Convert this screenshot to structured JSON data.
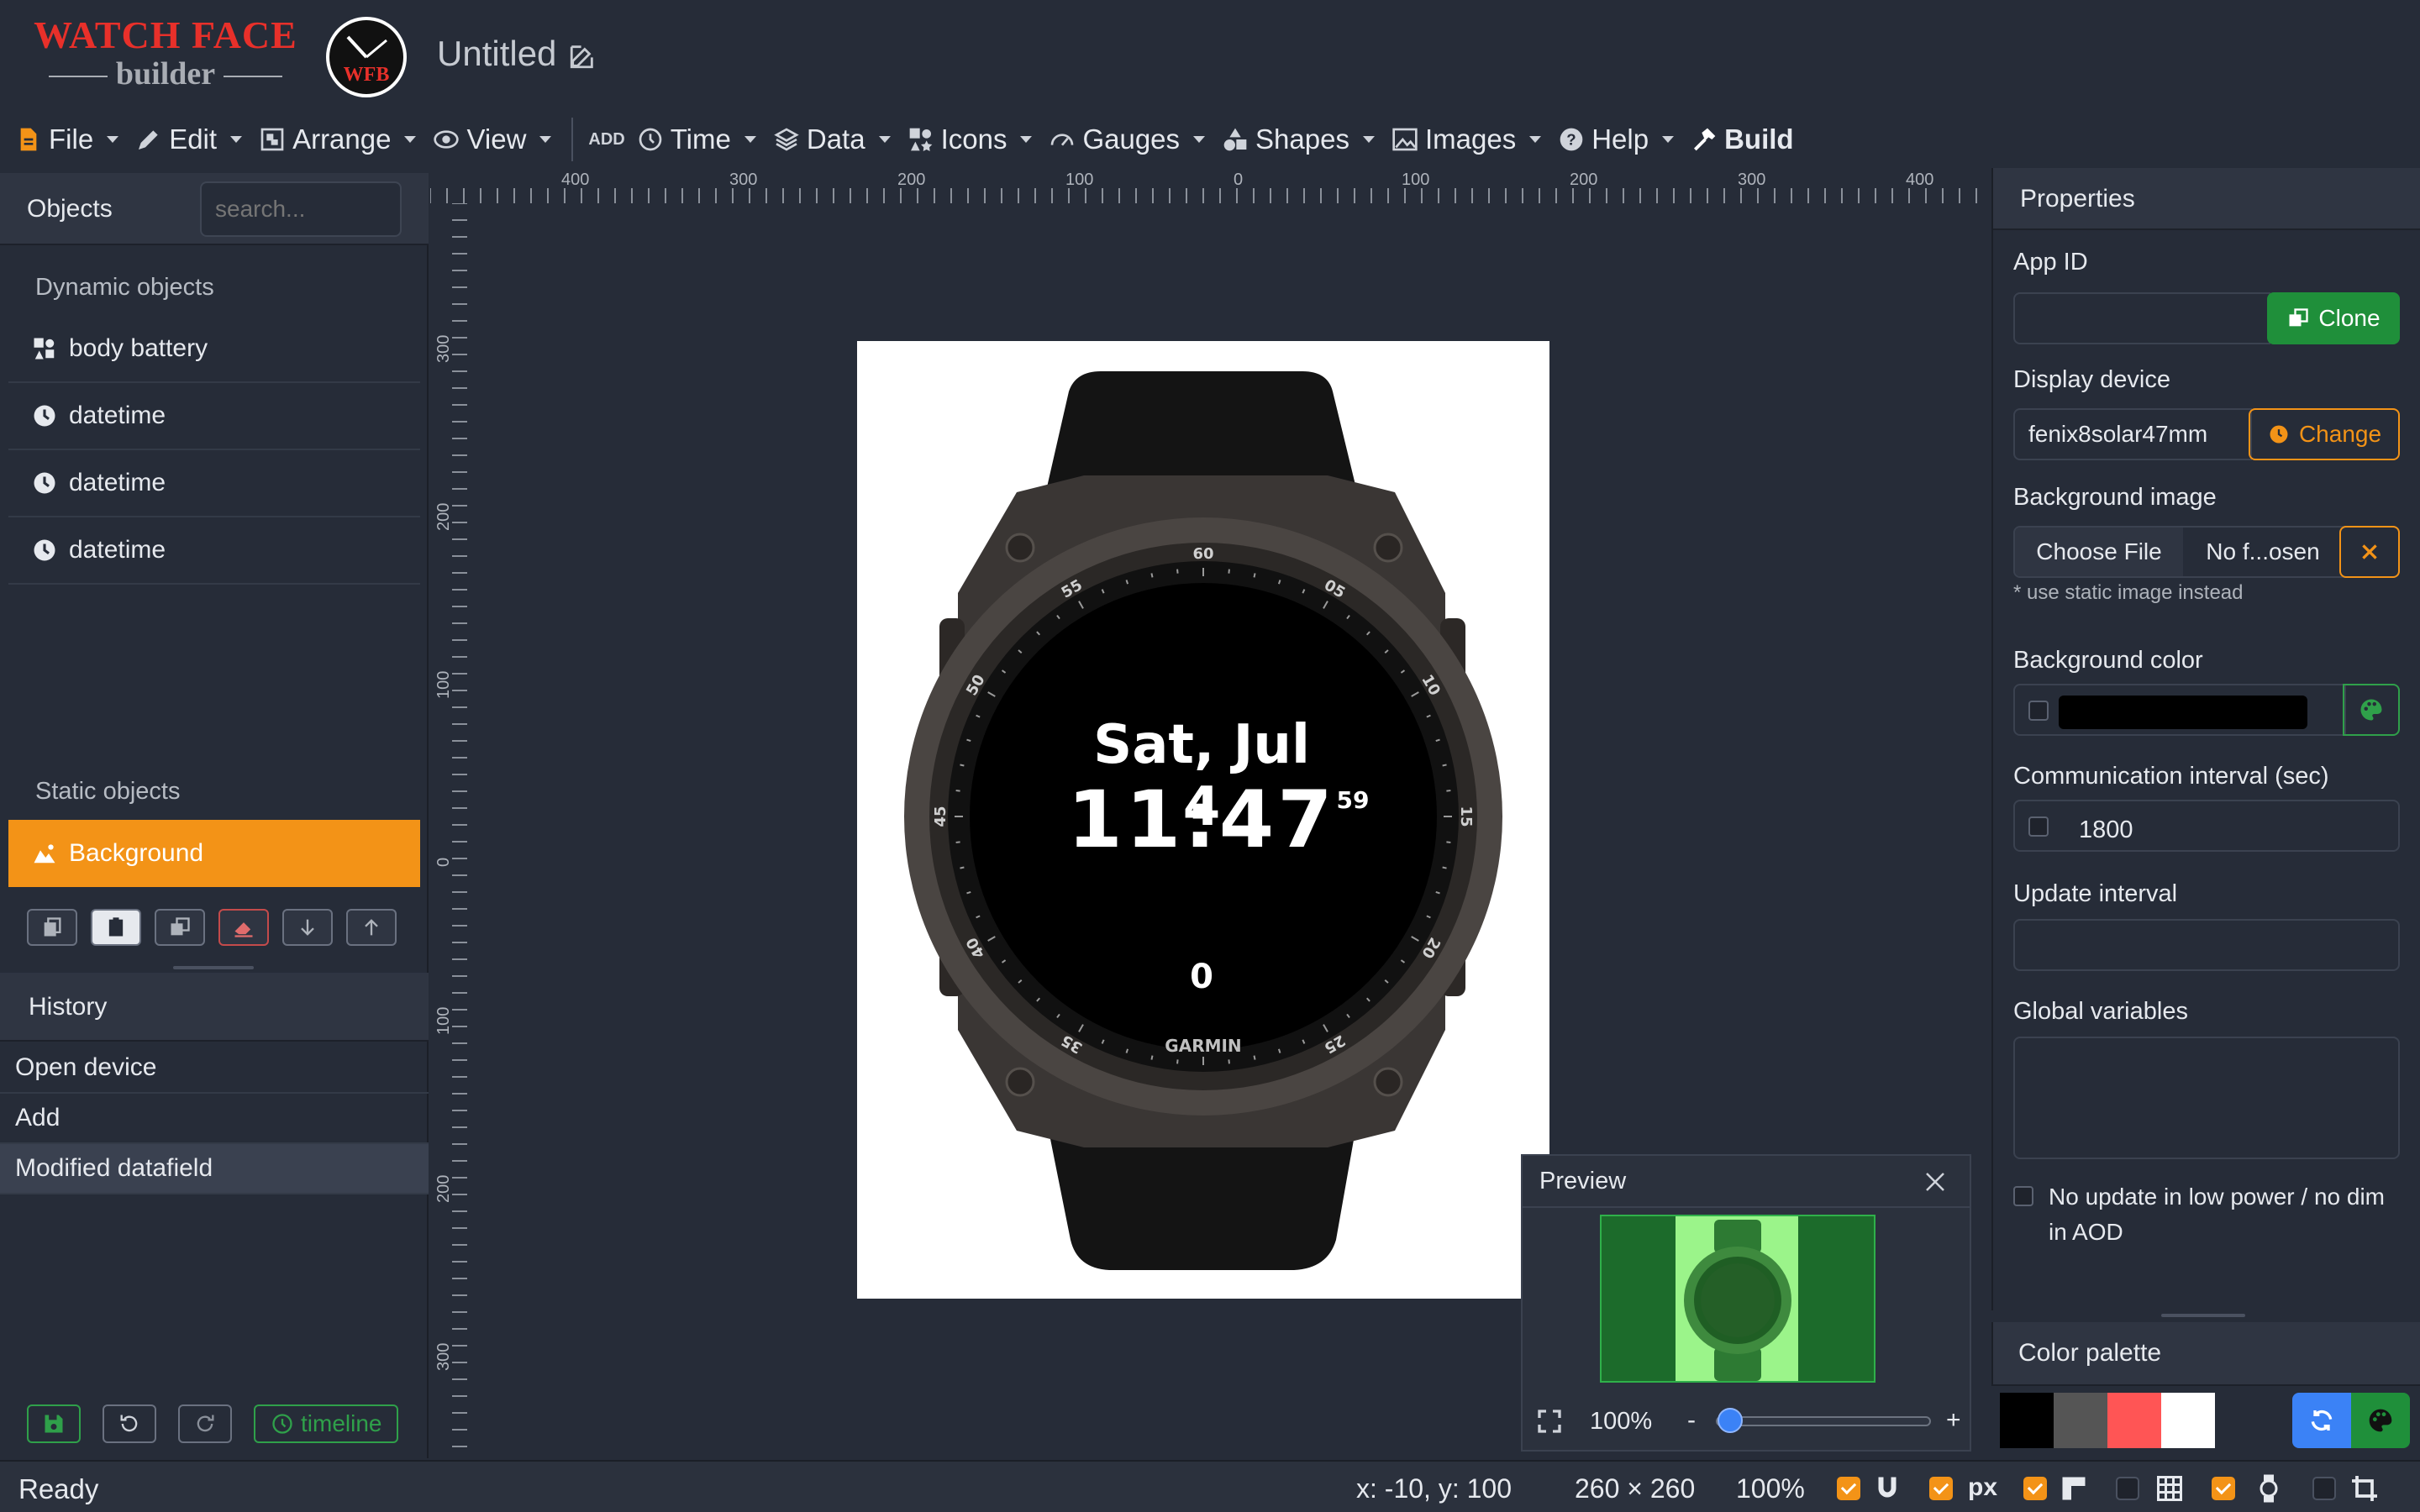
{
  "header": {
    "logo_line1": "WATCH FACE",
    "logo_line2": "builder",
    "badge_text": "WFB",
    "doc_title": "Untitled"
  },
  "menu": {
    "file": "File",
    "edit": "Edit",
    "arrange": "Arrange",
    "view": "View",
    "add": "ADD",
    "time": "Time",
    "data": "Data",
    "icons": "Icons",
    "gauges": "Gauges",
    "shapes": "Shapes",
    "images": "Images",
    "help": "Help",
    "build": "Build"
  },
  "objects": {
    "title": "Objects",
    "search_placeholder": "search...",
    "dynamic_title": "Dynamic objects",
    "dynamic_items": [
      {
        "label": "body battery",
        "icon": "data-icon"
      },
      {
        "label": "datetime",
        "icon": "clock-icon"
      },
      {
        "label": "datetime",
        "icon": "clock-icon"
      },
      {
        "label": "datetime",
        "icon": "clock-icon"
      }
    ],
    "static_title": "Static objects",
    "static_items": [
      {
        "label": "Background",
        "icon": "image-icon",
        "selected": true
      }
    ]
  },
  "history": {
    "title": "History",
    "items": [
      "Open device",
      "Add",
      "Modified datafield"
    ],
    "timeline_label": "timeline"
  },
  "rulers": {
    "top_labels": [
      "400",
      "300",
      "200",
      "100",
      "0",
      "100",
      "200",
      "300",
      "400"
    ],
    "left_labels": [
      "300",
      "200",
      "100",
      "0",
      "100",
      "200",
      "300"
    ]
  },
  "watch": {
    "date": "Sat, Jul 4",
    "time": "11:47",
    "seconds": "59",
    "battery": "0",
    "brand": "GARMIN",
    "bezel_numbers": [
      "60",
      "05",
      "10",
      "15",
      "20",
      "25",
      "35",
      "40",
      "45",
      "50",
      "55"
    ]
  },
  "preview": {
    "title": "Preview",
    "zoom": "100%",
    "zoom_fraction": 0.05,
    "minus": "-",
    "plus": "+"
  },
  "properties": {
    "title": "Properties",
    "app_id_label": "App ID",
    "app_id_value": "",
    "clone_label": "Clone",
    "display_device_label": "Display device",
    "display_device_value": "fenix8solar47mm",
    "change_label": "Change",
    "bg_image_label": "Background image",
    "choose_file_label": "Choose File",
    "file_name": "No f...osen",
    "bg_note": "* use static image instead",
    "bg_color_label": "Background color",
    "bg_color_value": "#000000",
    "comm_interval_label": "Communication interval (sec)",
    "comm_interval_value": "1800",
    "update_interval_label": "Update interval",
    "globals_label": "Global variables",
    "no_update_label": "No update in low power / no dim in AOD"
  },
  "palette": {
    "title": "Color palette",
    "colors": [
      "#000000",
      "#555555",
      "#ff5555",
      "#ffffff",
      "#262c38"
    ]
  },
  "status": {
    "text": "Ready",
    "coords": "x: -10, y: 100",
    "size": "260 × 260",
    "zoom": "100%",
    "px_label": "px"
  },
  "colors": {
    "accent": "#f39317",
    "success": "#1f8f3a",
    "primary": "#3b82f6",
    "brand_red": "#e8302a",
    "background": "#262c38"
  }
}
